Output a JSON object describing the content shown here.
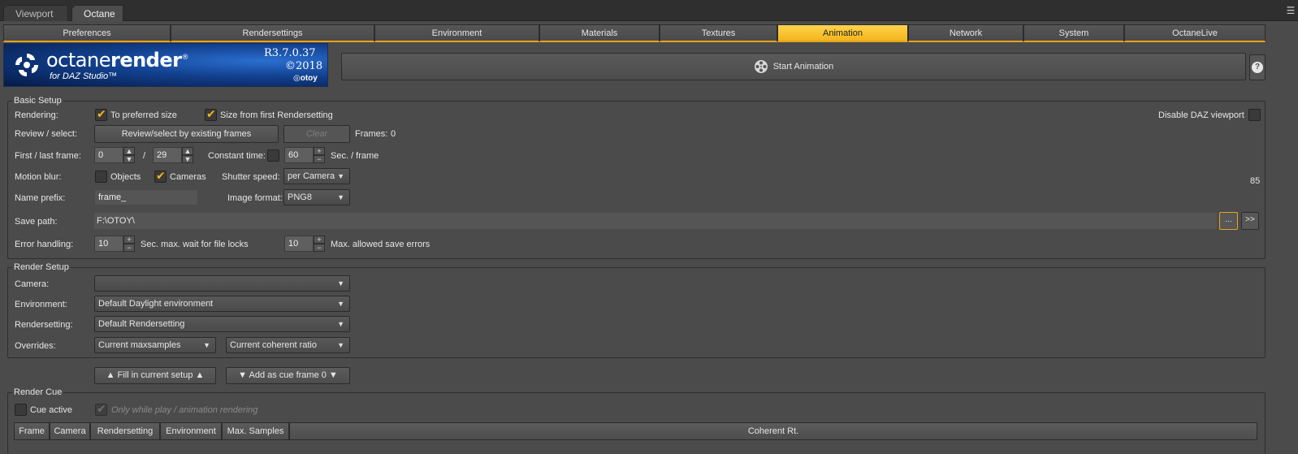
{
  "doc_tabs": [
    {
      "label": "Viewport",
      "active": false
    },
    {
      "label": "Octane",
      "active": true
    }
  ],
  "main_tabs": [
    {
      "label": "Preferences",
      "active": false
    },
    {
      "label": "Rendersettings",
      "active": false
    },
    {
      "label": "Environment",
      "active": false
    },
    {
      "label": "Materials",
      "active": false
    },
    {
      "label": "Textures",
      "active": false
    },
    {
      "label": "Animation",
      "active": true
    },
    {
      "label": "Network",
      "active": false
    },
    {
      "label": "System",
      "active": false
    },
    {
      "label": "OctaneLive",
      "active": false
    }
  ],
  "logo": {
    "title_light": "octane",
    "title_bold": "render",
    "subtitle": "for DAZ Studio™",
    "version": "R3.7.0.37",
    "year": "©2018",
    "brand": "otoy",
    "trademark": "®"
  },
  "start_button_label": "Start Animation",
  "help_label": "?",
  "basic_setup": {
    "title": "Basic Setup",
    "rendering_label": "Rendering:",
    "to_preferred_size": {
      "label": "To preferred size",
      "checked": true
    },
    "size_from_first": {
      "label": "Size from first Rendersetting",
      "checked": true
    },
    "disable_daz_viewport": {
      "label": "Disable DAZ viewport",
      "checked": false
    },
    "review_label": "Review / select:",
    "review_button": "Review/select by existing frames",
    "clear_button": "Clear",
    "frames_label": "Frames:",
    "frames_value": "0",
    "first_last_label": "First / last frame:",
    "first_frame": "0",
    "slash": "/",
    "last_frame": "29",
    "constant_time_label": "Constant time:",
    "constant_time_checked": false,
    "constant_time_value": "60",
    "sec_frame_label": "Sec. / frame",
    "motion_blur_label": "Motion blur:",
    "objects": {
      "label": "Objects",
      "checked": false
    },
    "cameras": {
      "label": "Cameras",
      "checked": true
    },
    "shutter_speed_label": "Shutter speed:",
    "shutter_speed_value": "per Camera",
    "quality_value": "85",
    "name_prefix_label": "Name prefix:",
    "name_prefix_value": "frame_",
    "image_format_label": "Image format:",
    "image_format_value": "PNG8",
    "save_path_label": "Save path:",
    "save_path_value": "F:\\OTOY\\",
    "browse_button": "...",
    "forward_button": ">>",
    "error_handling_label": "Error handling:",
    "wait_value": "10",
    "wait_label": "Sec. max. wait for file locks",
    "max_errors_value": "10",
    "max_errors_label": "Max. allowed save errors"
  },
  "render_setup": {
    "title": "Render Setup",
    "camera_label": "Camera:",
    "camera_value": "",
    "environment_label": "Environment:",
    "environment_value": "Default Daylight environment",
    "rendersetting_label": "Rendersetting:",
    "rendersetting_value": "Default Rendersetting",
    "overrides_label": "Overrides:",
    "maxsamples_value": "Current maxsamples",
    "coherent_value": "Current coherent ratio",
    "fill_button": "▲ Fill in current setup ▲",
    "add_button": "▼ Add as cue frame 0 ▼"
  },
  "render_cue": {
    "title": "Render Cue",
    "cue_active": {
      "label": "Cue active",
      "checked": false
    },
    "only_while_play": {
      "label": "Only while play / animation rendering",
      "checked": true
    },
    "columns": [
      "Frame",
      "Camera",
      "Rendersetting",
      "Environment",
      "Max. Samples",
      "Coherent Rt."
    ]
  },
  "colors": {
    "accent": "#f2b51c",
    "background": "#4b4b4b",
    "border": "#2e2e2e"
  }
}
